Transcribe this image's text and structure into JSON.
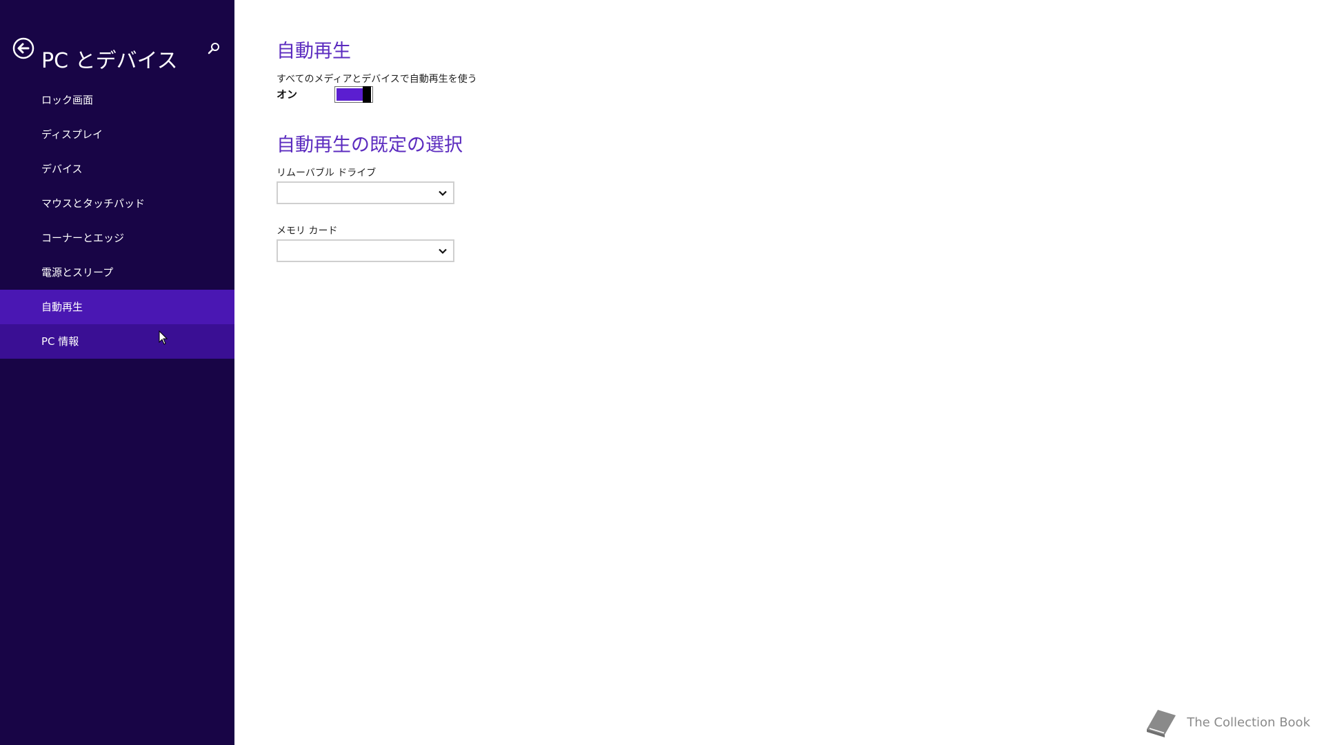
{
  "sidebar": {
    "title": "PC とデバイス",
    "items": [
      {
        "label": "ロック画面"
      },
      {
        "label": "ディスプレイ"
      },
      {
        "label": "デバイス"
      },
      {
        "label": "マウスとタッチパッド"
      },
      {
        "label": "コーナーとエッジ"
      },
      {
        "label": "電源とスリープ"
      },
      {
        "label": "自動再生"
      },
      {
        "label": "PC 情報"
      }
    ],
    "selected_index": 6
  },
  "main": {
    "autoplay": {
      "heading": "自動再生",
      "toggle_label": "すべてのメディアとデバイスで自動再生を使う",
      "toggle_state": "オン"
    },
    "defaults": {
      "heading": "自動再生の既定の選択",
      "removable_label": "リムーバブル ドライブ",
      "removable_value": "",
      "memory_label": "メモリ カード",
      "memory_value": ""
    }
  },
  "watermark": {
    "text": "The Collection Book"
  },
  "colors": {
    "sidebar_bg": "#180546",
    "selected_bg": "#4a17b3",
    "accent": "#5b2bbf",
    "toggle_on": "#5b1ed0"
  },
  "icons": [
    "back-arrow-icon",
    "search-icon",
    "chevron-down-icon",
    "book-icon",
    "mouse-cursor-icon"
  ]
}
